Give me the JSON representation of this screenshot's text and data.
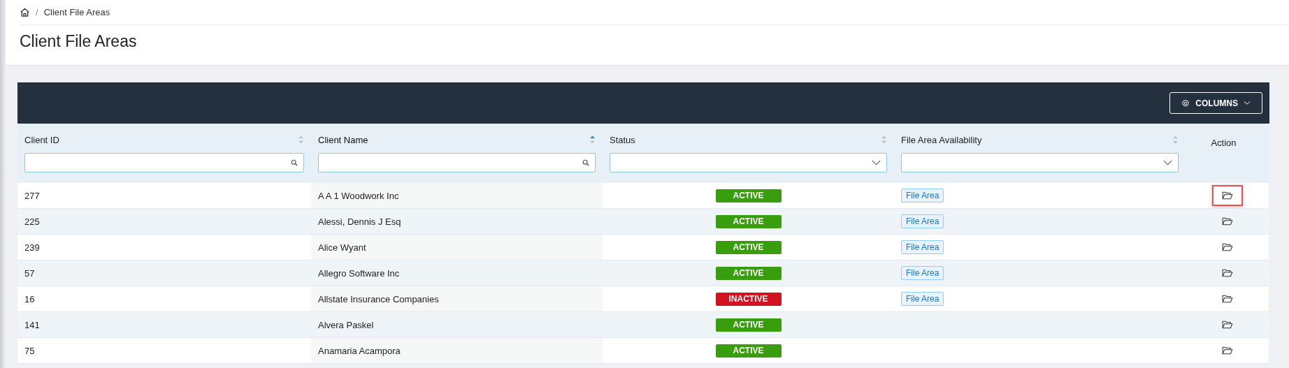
{
  "breadcrumb": {
    "separator": "/",
    "current": "Client File Areas"
  },
  "title": "Client File Areas",
  "toolbar": {
    "columns_button": "COLUMNS"
  },
  "columns": [
    {
      "label": "Client ID",
      "sortable": true,
      "sorted": false,
      "kind": "search"
    },
    {
      "label": "Client Name",
      "sortable": true,
      "sorted": true,
      "kind": "search"
    },
    {
      "label": "Status",
      "sortable": true,
      "sorted": false,
      "kind": "dropdown"
    },
    {
      "label": "File Area Availability",
      "sortable": true,
      "sorted": false,
      "kind": "dropdown"
    },
    {
      "label": "Action",
      "sortable": false,
      "sorted": false,
      "kind": "plain"
    }
  ],
  "rows": [
    {
      "id": "277",
      "name": "A A 1 Woodwork Inc",
      "status": "ACTIVE",
      "active": true,
      "file_area": "File Area",
      "highlighted": true
    },
    {
      "id": "225",
      "name": "Alessi, Dennis J Esq",
      "status": "ACTIVE",
      "active": true,
      "file_area": "File Area",
      "highlighted": false
    },
    {
      "id": "239",
      "name": "Alice Wyant",
      "status": "ACTIVE",
      "active": true,
      "file_area": "File Area",
      "highlighted": false
    },
    {
      "id": "57",
      "name": "Allegro Software Inc",
      "status": "ACTIVE",
      "active": true,
      "file_area": "File Area",
      "highlighted": false
    },
    {
      "id": "16",
      "name": "Allstate Insurance Companies",
      "status": "INACTIVE",
      "active": false,
      "file_area": "File Area",
      "highlighted": false
    },
    {
      "id": "141",
      "name": "Alvera Paskel",
      "status": "ACTIVE",
      "active": true,
      "highlighted": false
    },
    {
      "id": "75",
      "name": "Anamaria Acampora",
      "status": "ACTIVE",
      "active": true,
      "highlighted": false
    }
  ]
}
